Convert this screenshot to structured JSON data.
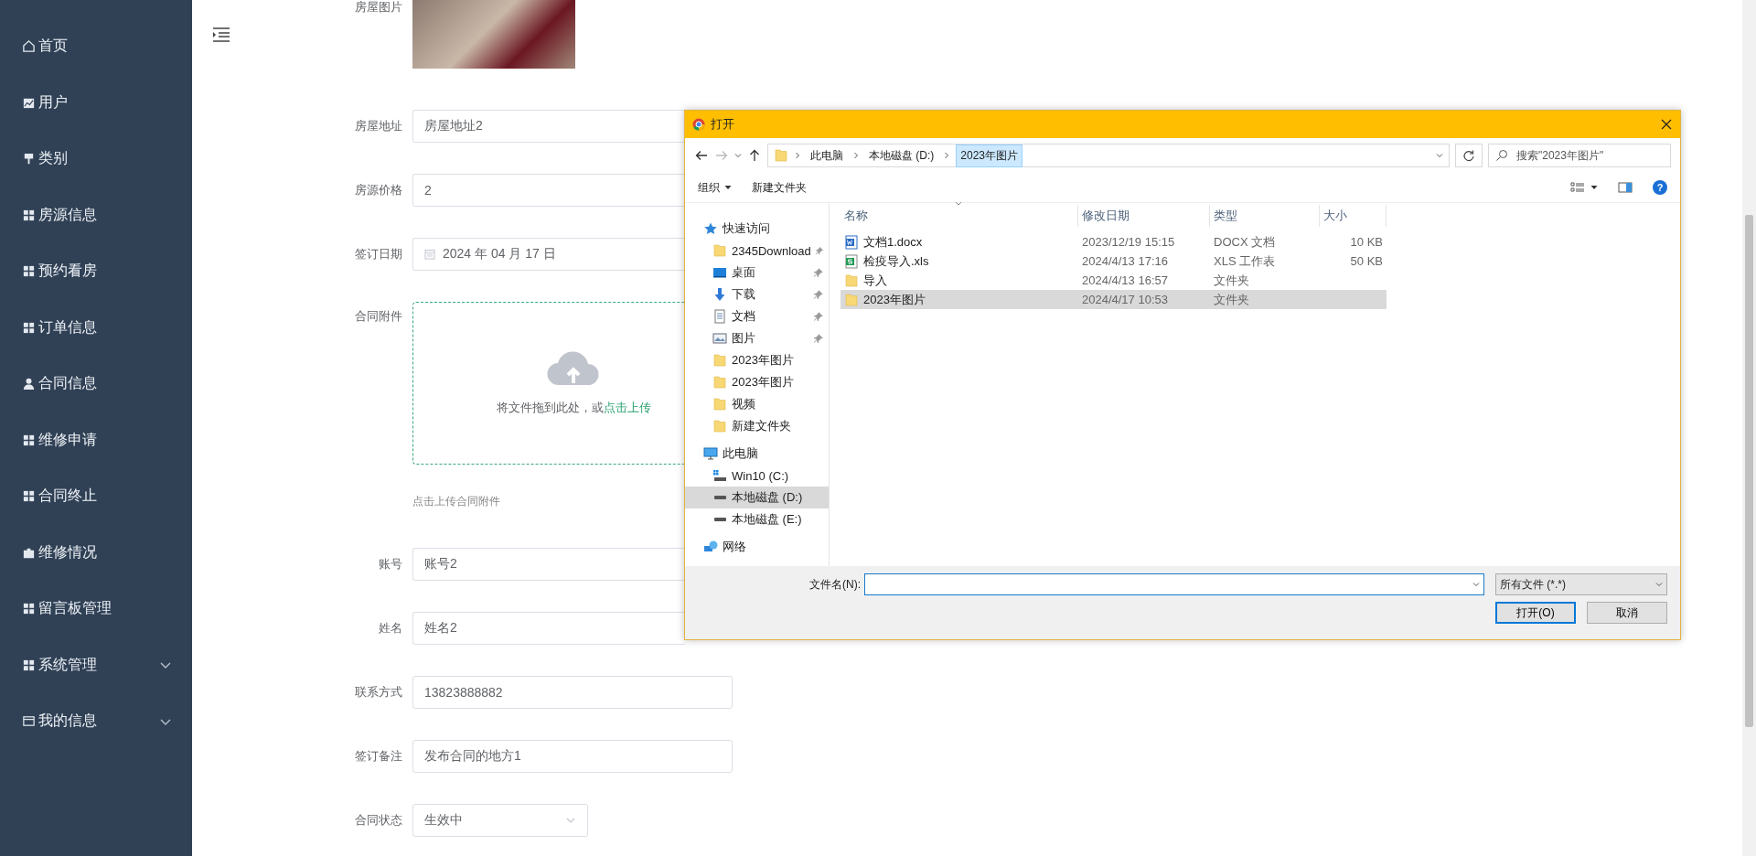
{
  "sidebar": {
    "items": [
      {
        "label": "首页",
        "kind": "link"
      },
      {
        "label": "用户",
        "kind": "link"
      },
      {
        "label": "类别",
        "kind": "link"
      },
      {
        "label": "房源信息",
        "kind": "link"
      },
      {
        "label": "预约看房",
        "kind": "link"
      },
      {
        "label": "订单信息",
        "kind": "link"
      },
      {
        "label": "合同信息",
        "kind": "link"
      },
      {
        "label": "维修申请",
        "kind": "link"
      },
      {
        "label": "合同终止",
        "kind": "link"
      },
      {
        "label": "维修情况",
        "kind": "link"
      },
      {
        "label": "留言板管理",
        "kind": "link"
      },
      {
        "label": "系统管理",
        "kind": "submenu"
      },
      {
        "label": "我的信息",
        "kind": "submenu"
      }
    ]
  },
  "form": {
    "fields": [
      {
        "label": "房屋图片",
        "kind": "image"
      },
      {
        "label": "房屋地址",
        "kind": "text",
        "value": "房屋地址2"
      },
      {
        "label": "房源价格",
        "kind": "text",
        "value": "2"
      },
      {
        "label": "签订日期",
        "kind": "date",
        "value": "2024 年 04 月 17 日"
      },
      {
        "label": "合同附件",
        "kind": "upload",
        "text": "将文件拖到此处，或",
        "link": "点击上传",
        "hint": "点击上传合同附件"
      },
      {
        "label": "账号",
        "kind": "text",
        "value": "账号2"
      },
      {
        "label": "姓名",
        "kind": "text",
        "value": "姓名2"
      },
      {
        "label": "联系方式",
        "kind": "text",
        "value": "13823888882"
      },
      {
        "label": "签订备注",
        "kind": "text",
        "value": "发布合同的地方1"
      },
      {
        "label": "合同状态",
        "kind": "select",
        "value": "生效中"
      }
    ]
  },
  "dialog": {
    "title": "打开",
    "breadcrumbs": [
      {
        "label": "此电脑",
        "selected": false
      },
      {
        "label": "本地磁盘 (D:)",
        "selected": false
      },
      {
        "label": "2023年图片",
        "selected": true
      }
    ],
    "search": {
      "placeholder": "搜索\"2023年图片\""
    },
    "toolbar": {
      "organize": "组织",
      "new_folder": "新建文件夹",
      "help": "?"
    },
    "nav": [
      {
        "label": "快速访问",
        "kind": "star",
        "selected": false,
        "children": [
          {
            "label": "2345Download",
            "kind": "folder",
            "pinned": true,
            "selected": false
          },
          {
            "label": "桌面",
            "kind": "desktop",
            "pinned": true,
            "selected": false
          },
          {
            "label": "下载",
            "kind": "download",
            "pinned": true,
            "selected": false
          },
          {
            "label": "文档",
            "kind": "documents",
            "pinned": true,
            "selected": false
          },
          {
            "label": "图片",
            "kind": "pictures",
            "pinned": true,
            "selected": false
          },
          {
            "label": "2023年图片",
            "kind": "folder",
            "pinned": false,
            "selected": false
          },
          {
            "label": "2023年图片",
            "kind": "folder",
            "pinned": false,
            "selected": false
          },
          {
            "label": "视频",
            "kind": "folder",
            "pinned": false,
            "selected": false
          },
          {
            "label": "新建文件夹",
            "kind": "folder",
            "pinned": false,
            "selected": false
          }
        ]
      },
      {
        "label": "此电脑",
        "kind": "computer",
        "selected": false,
        "children": [
          {
            "label": "Win10 (C:)",
            "kind": "system-drive",
            "selected": false
          },
          {
            "label": "本地磁盘 (D:)",
            "kind": "drive",
            "selected": true
          },
          {
            "label": "本地磁盘 (E:)",
            "kind": "drive",
            "selected": false
          }
        ]
      },
      {
        "label": "网络",
        "kind": "network",
        "selected": false
      }
    ],
    "columns": [
      "名称",
      "修改日期",
      "类型",
      "大小"
    ],
    "files": [
      {
        "name": "文档1.docx",
        "kind": "word",
        "date": "2023/12/19 15:15",
        "type": "DOCX 文档",
        "size": "10 KB",
        "selected": false
      },
      {
        "name": "检疫导入.xls",
        "kind": "excel",
        "date": "2024/4/13 17:16",
        "type": "XLS 工作表",
        "size": "50 KB",
        "selected": false
      },
      {
        "name": "导入",
        "kind": "folder",
        "date": "2024/4/13 16:57",
        "type": "文件夹",
        "selected": false
      },
      {
        "name": "2023年图片",
        "kind": "folder",
        "date": "2024/4/17 10:53",
        "type": "文件夹",
        "selected": true
      }
    ],
    "filename_label": "文件名(N):",
    "filter": "所有文件 (*.*)",
    "buttons": [
      {
        "label": "打开(O)",
        "default": true
      },
      {
        "label": "取消",
        "default": false
      }
    ]
  }
}
